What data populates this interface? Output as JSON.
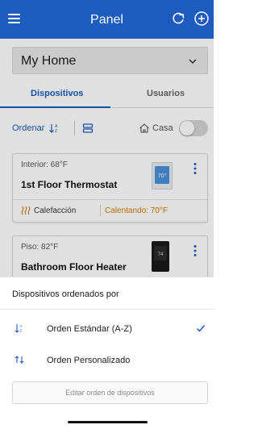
{
  "header": {
    "title": "Panel"
  },
  "home_select": {
    "value": "My Home"
  },
  "tabs": [
    {
      "label": "Dispositivos",
      "active": true
    },
    {
      "label": "Usuarios",
      "active": false
    }
  ],
  "toolbar": {
    "sort_label": "Ordenar",
    "home_label": "Casa",
    "home_toggle_on": false
  },
  "devices": [
    {
      "meta": "Interior: 68°F",
      "name": "1st Floor Thermostat",
      "mode": "Calefacción",
      "status": "Calentando: 70°F",
      "screen_value": "70°"
    },
    {
      "meta": "Piso: 82°F",
      "name": "Bathroom Floor Heater",
      "screen_value": "74"
    }
  ],
  "sort_sheet": {
    "title": "Dispositivos ordenados por",
    "options": [
      {
        "label": "Orden Estándar (A-Z)",
        "selected": true
      },
      {
        "label": "Orden Personalizado",
        "selected": false
      }
    ],
    "edit_button": "Editar orden de dispositivos"
  },
  "colors": {
    "brand": "#1d5bbf",
    "heating": "#d07a00"
  }
}
